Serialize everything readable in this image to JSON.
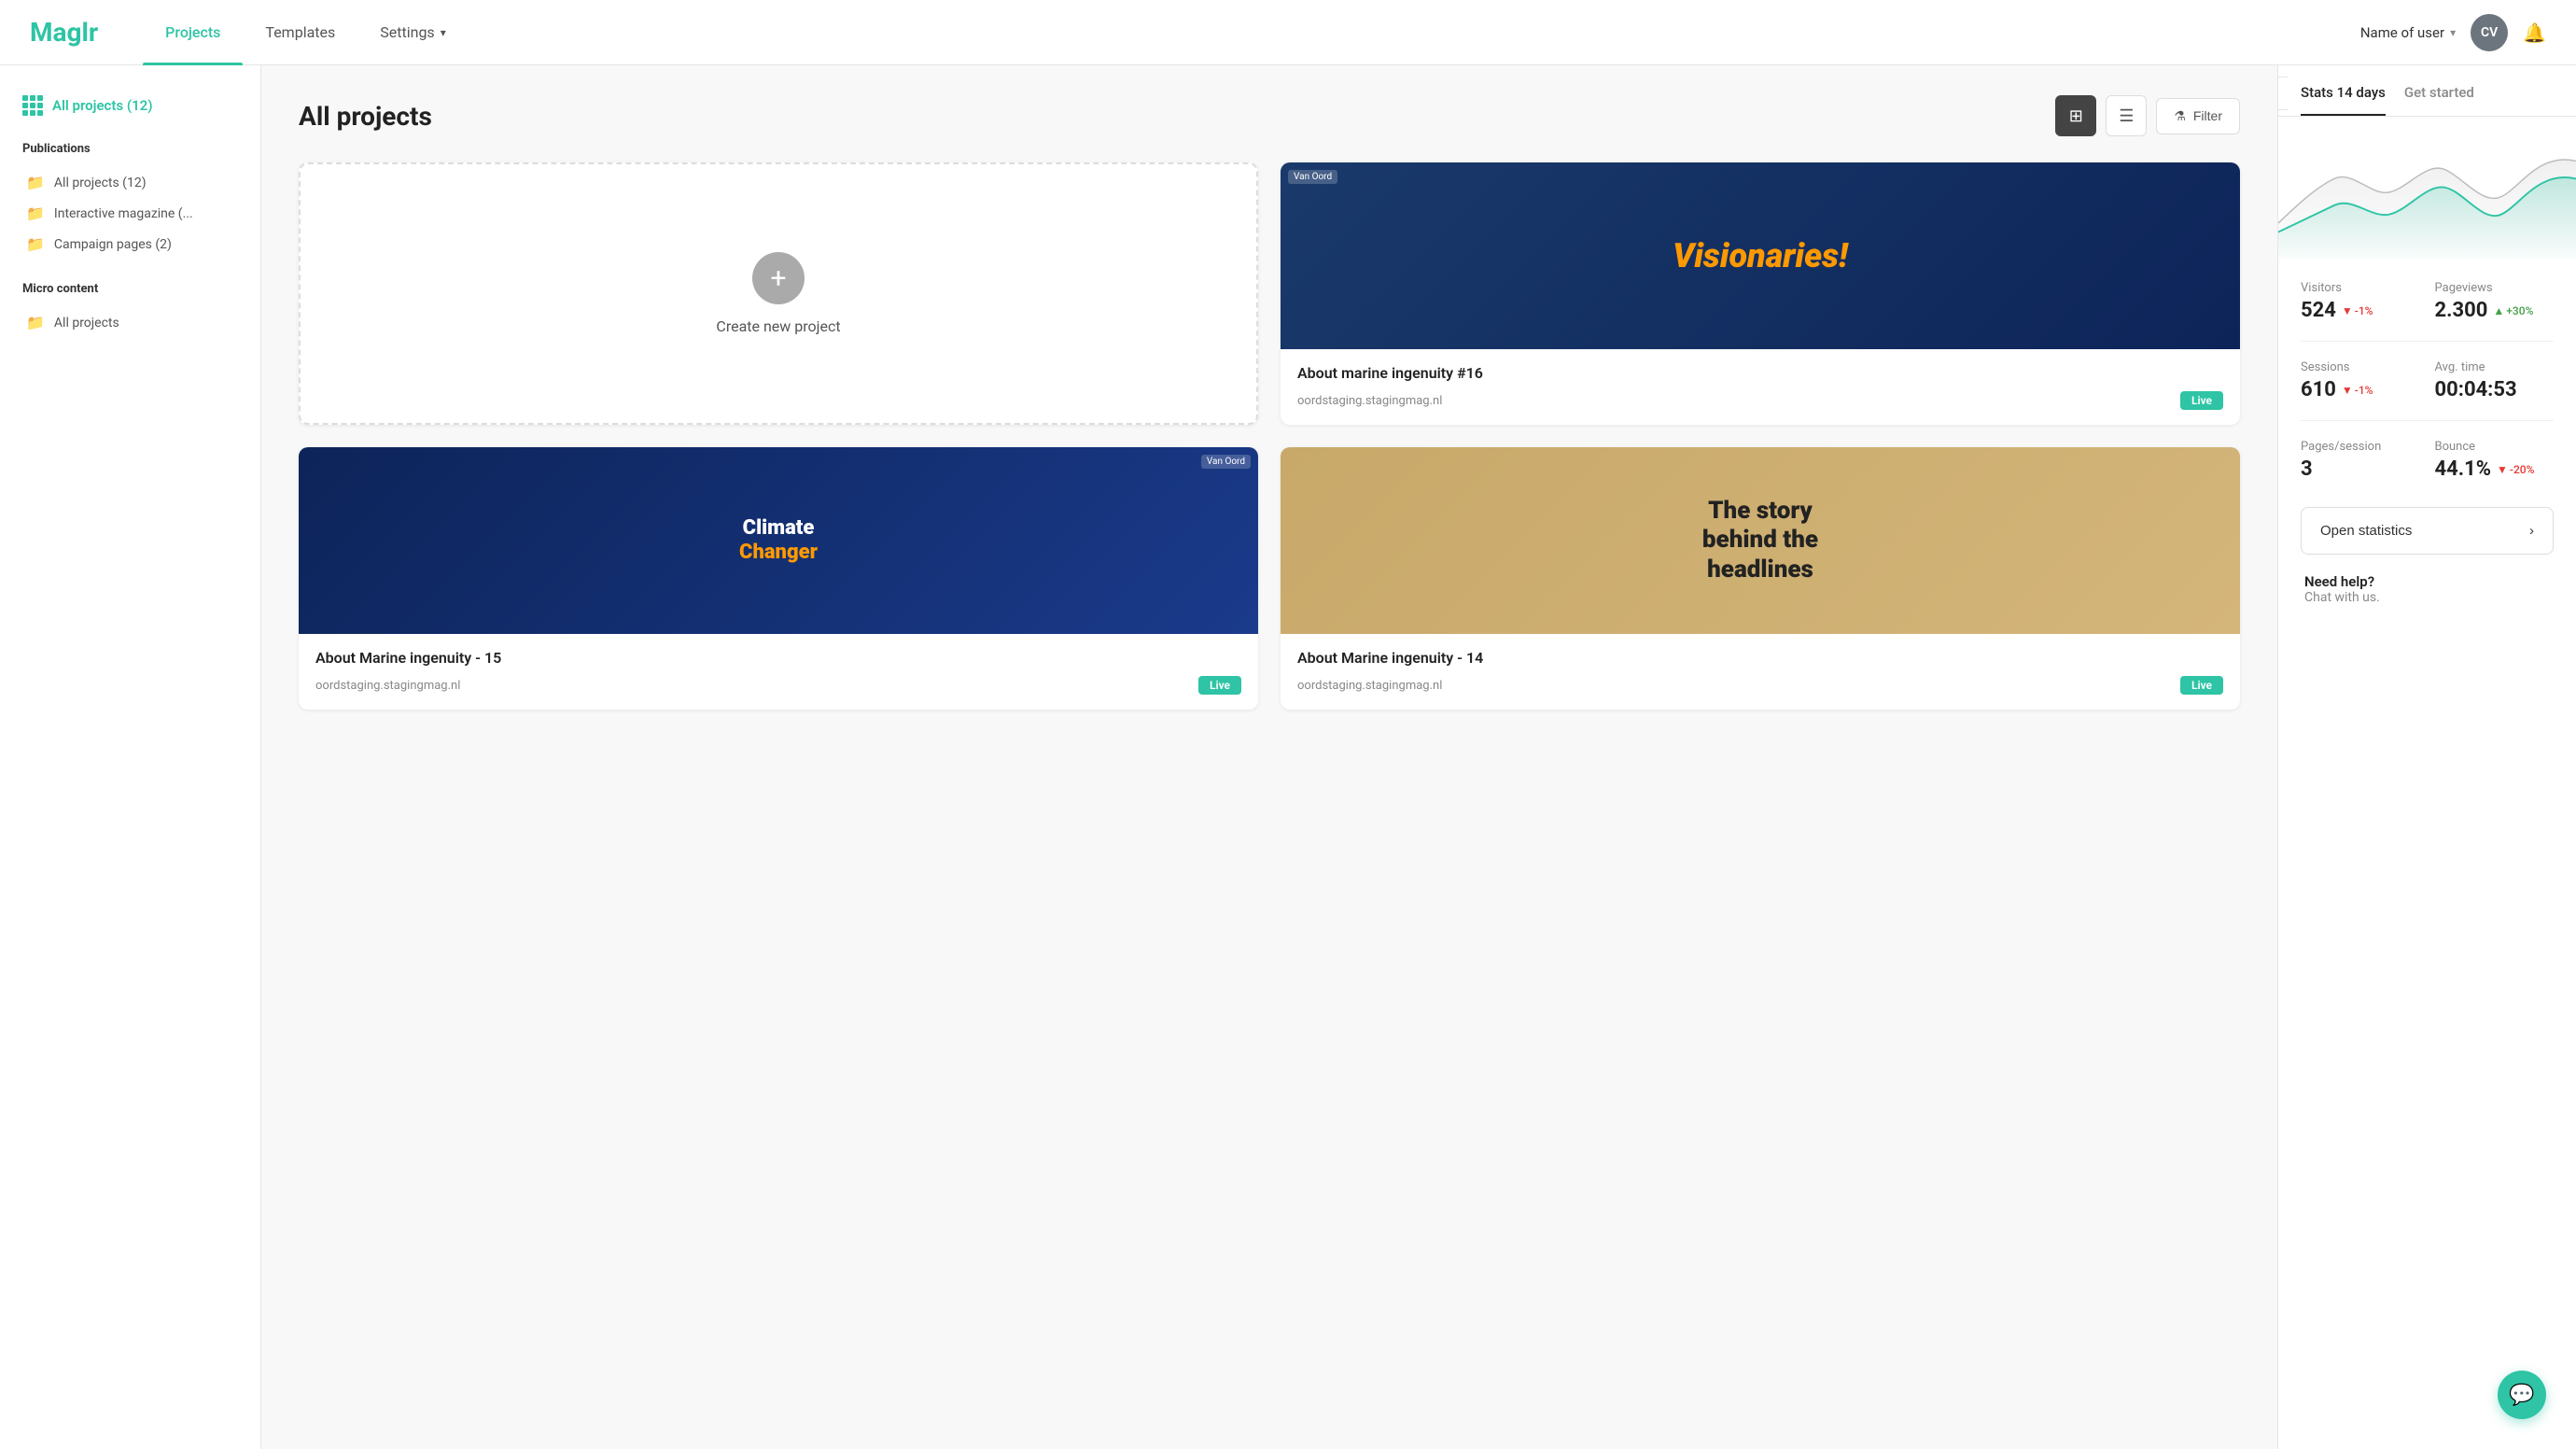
{
  "header": {
    "logo": "Maglr",
    "nav": [
      {
        "id": "projects",
        "label": "Projects",
        "active": true
      },
      {
        "id": "templates",
        "label": "Templates",
        "active": false
      },
      {
        "id": "settings",
        "label": "Settings",
        "active": false,
        "hasChevron": true
      }
    ],
    "user": {
      "name": "Name of user",
      "initials": "CV"
    },
    "bell_label": "notifications"
  },
  "sidebar": {
    "all_projects_label": "All projects (12)",
    "sections": [
      {
        "id": "publications",
        "title": "Publications",
        "items": [
          {
            "id": "all",
            "label": "All projects (12)"
          },
          {
            "id": "magazine",
            "label": "Interactive magazine (..."
          },
          {
            "id": "campaign",
            "label": "Campaign pages (2)"
          }
        ]
      },
      {
        "id": "micro",
        "title": "Micro content",
        "items": [
          {
            "id": "micro-all",
            "label": "All projects"
          }
        ]
      }
    ]
  },
  "content": {
    "title": "All projects",
    "toolbar": {
      "grid_label": "Grid view",
      "list_label": "List view",
      "filter_label": "Filter"
    },
    "create_project_label": "Create new project",
    "projects": [
      {
        "id": "visionaries",
        "name": "About marine ingenuity #16",
        "url": "oordstaging.stagingmag.nl",
        "status": "Live",
        "thumb_type": "visionaries",
        "thumb_text": "Visionaries!"
      },
      {
        "id": "climate",
        "name": "About Marine ingenuity - 15",
        "url": "oordstaging.stagingmag.nl",
        "status": "Live",
        "thumb_type": "climate",
        "thumb_text": "Climate Changer"
      },
      {
        "id": "headlines",
        "name": "About Marine ingenuity - 14",
        "url": "oordstaging.stagingmag.nl",
        "status": "Live",
        "thumb_type": "headlines",
        "thumb_text": "The story behind the headlines"
      }
    ]
  },
  "stats": {
    "tabs": [
      {
        "id": "stats14",
        "label": "Stats 14 days",
        "active": true
      },
      {
        "id": "getstarted",
        "label": "Get started",
        "active": false
      }
    ],
    "metrics": [
      {
        "id": "visitors",
        "label": "Visitors",
        "value": "524",
        "change": "-1%",
        "direction": "down"
      },
      {
        "id": "pageviews",
        "label": "Pageviews",
        "value": "2.300",
        "change": "+30%",
        "direction": "up"
      },
      {
        "id": "sessions",
        "label": "Sessions",
        "value": "610",
        "change": "-1%",
        "direction": "down"
      },
      {
        "id": "avgtime",
        "label": "Avg. time",
        "value": "00:04:53",
        "change": "",
        "direction": ""
      },
      {
        "id": "pages_session",
        "label": "Pages/session",
        "value": "3",
        "change": "",
        "direction": ""
      },
      {
        "id": "bounce",
        "label": "Bounce",
        "value": "44.1%",
        "change": "-20%",
        "direction": "down"
      }
    ],
    "open_stats_label": "Open statistics",
    "need_help": {
      "title": "Need help?",
      "subtitle": "Chat with us."
    }
  }
}
